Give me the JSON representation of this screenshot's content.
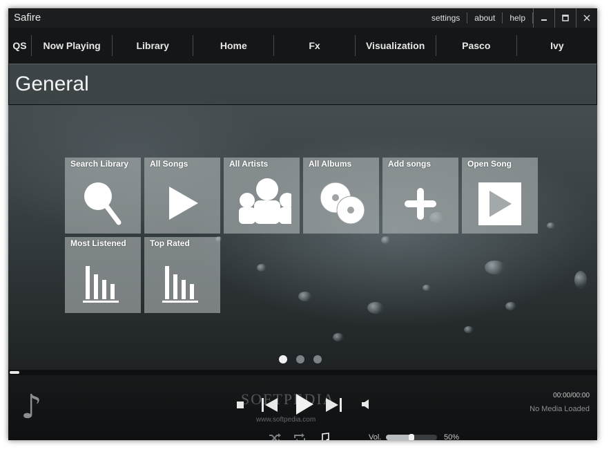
{
  "window": {
    "title": "Safire"
  },
  "title_links": [
    "settings",
    "about",
    "help"
  ],
  "window_controls": [
    "minimize-icon",
    "maximize-icon",
    "close-icon"
  ],
  "nav": {
    "qs": "QS",
    "items": [
      "Now Playing",
      "Library",
      "Home",
      "Fx",
      "Visualization",
      "Pasco",
      "Ivy"
    ]
  },
  "section": {
    "title": "General"
  },
  "tiles": [
    {
      "label": "Search Library",
      "icon": "search-icon"
    },
    {
      "label": "All Songs",
      "icon": "play-icon"
    },
    {
      "label": "All Artists",
      "icon": "people-icon"
    },
    {
      "label": "All Albums",
      "icon": "discs-icon"
    },
    {
      "label": "Add songs",
      "icon": "plus-icon"
    },
    {
      "label": "Open Song",
      "icon": "open-play-icon"
    },
    {
      "label": "Most Listened",
      "icon": "bar-chart-icon"
    },
    {
      "label": "Top Rated",
      "icon": "bar-chart-icon"
    }
  ],
  "pager": {
    "pages": 3,
    "active": 0
  },
  "player": {
    "time": "00:00/00:00",
    "status": "No Media Loaded",
    "watermark": "SOFTPEDIA",
    "watermark_url": "www.softpedia.com",
    "progress": 0.0,
    "volume_label": "Vol.",
    "volume_value": "50%",
    "volume_level": 0.5,
    "controls": [
      "stop-icon",
      "previous-icon",
      "play-icon",
      "next-icon",
      "volume-icon"
    ],
    "modes": [
      "shuffle-icon",
      "repeat-icon",
      "music-note-icon"
    ]
  },
  "colors": {
    "accent": "#f2f2f2",
    "tile_bg": "#afb4b6",
    "window_bg": "#1a1c1e"
  }
}
